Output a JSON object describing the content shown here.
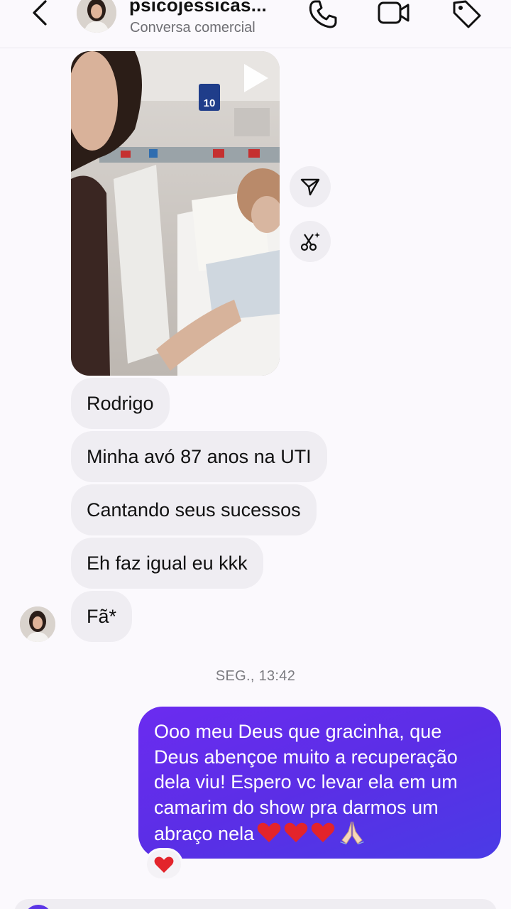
{
  "header": {
    "name": "psicojessicas...",
    "subtitle": "Conversa comercial",
    "icons": [
      "back-icon",
      "phone-icon",
      "video-icon",
      "tag-icon"
    ]
  },
  "media": {
    "room_sign": "10",
    "actions": [
      "send-icon",
      "scissors-sparkle-icon",
      "play-icon"
    ]
  },
  "messages_in": [
    {
      "text": "Rodrigo"
    },
    {
      "text": "Minha avó 87 anos na UTI"
    },
    {
      "text": "Cantando seus sucessos"
    },
    {
      "text": "Eh faz igual eu kkk"
    },
    {
      "text": "Fã*"
    }
  ],
  "timestamp": "SEG., 13:42",
  "message_out": {
    "lines": [
      "Ooo meu Deus que gracinha, que",
      "Deus abençoe muito a recuperação",
      "dela viu! Espero vc levar ela em um",
      "camarim do show pra darmos um",
      "abraço nela"
    ],
    "emojis": [
      "red-heart",
      "red-heart",
      "red-heart",
      "folded-hands"
    ],
    "reaction": "red-heart"
  },
  "colors": {
    "outgoing_gradient_start": "#6b2cf0",
    "outgoing_gradient_end": "#4a3be6",
    "incoming_bubble": "#efedf2",
    "background": "#fbf9fd"
  }
}
